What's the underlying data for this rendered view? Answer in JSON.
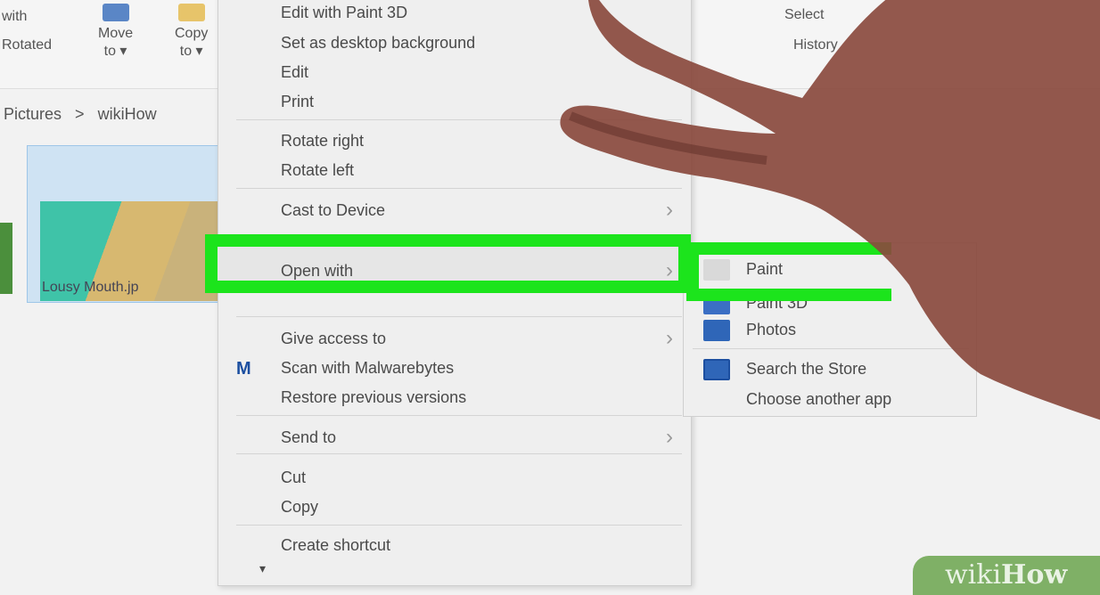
{
  "ribbon": {
    "items": [
      {
        "label": "with",
        "sub": "",
        "icon": "cut-icon"
      },
      {
        "label": "",
        "sub": "Rotated",
        "icon": "text-icon"
      },
      {
        "label": "Move",
        "sub": "to ▾",
        "icon": "move-to-icon"
      },
      {
        "label": "Copy",
        "sub": "to ▾",
        "icon": "copy-to-icon"
      }
    ],
    "right_items": [
      "Select",
      "History"
    ]
  },
  "address": {
    "parts": [
      "Pictures",
      "wikiHow"
    ]
  },
  "file": {
    "name": "Lousy Mouth.jp"
  },
  "context_menu": {
    "items": [
      {
        "label": "Edit with Paint 3D",
        "group": 1
      },
      {
        "label": "Set as desktop background",
        "group": 1
      },
      {
        "label": "Edit",
        "group": 1
      },
      {
        "label": "Print",
        "group": 1
      },
      {
        "label": "Rotate right",
        "group": 2
      },
      {
        "label": "Rotate left",
        "group": 2
      },
      {
        "label": "Cast to Device",
        "group": 3,
        "submenu": true
      },
      {
        "label": "Open with",
        "group": 4,
        "submenu": true,
        "highlighted": true
      },
      {
        "label": "Give access to",
        "group": 5,
        "submenu": true
      },
      {
        "label": "Scan with Malwarebytes",
        "group": 5,
        "icon": "malwarebytes-icon"
      },
      {
        "label": "Restore previous versions",
        "group": 5
      },
      {
        "label": "Send to",
        "group": 6,
        "submenu": true
      },
      {
        "label": "Cut",
        "group": 7
      },
      {
        "label": "Copy",
        "group": 7
      },
      {
        "label": "Create shortcut",
        "group": 8
      }
    ],
    "more_arrow": "▾"
  },
  "submenu": {
    "items": [
      {
        "label": "Paint",
        "icon": "paint-icon",
        "highlighted": true
      },
      {
        "label": "Paint 3D",
        "icon": "paint3d-icon"
      },
      {
        "label": "Photos",
        "icon": "photos-icon"
      },
      {
        "label": "Search the Store",
        "icon": "store-icon"
      },
      {
        "label": "Choose another app",
        "icon": ""
      }
    ]
  },
  "watermark": {
    "text_a": "wiki",
    "text_b": "How"
  },
  "colors": {
    "highlight": "#1ce41c",
    "menu_bg": "#efefef",
    "hand_skin": "#8a4a3e"
  }
}
